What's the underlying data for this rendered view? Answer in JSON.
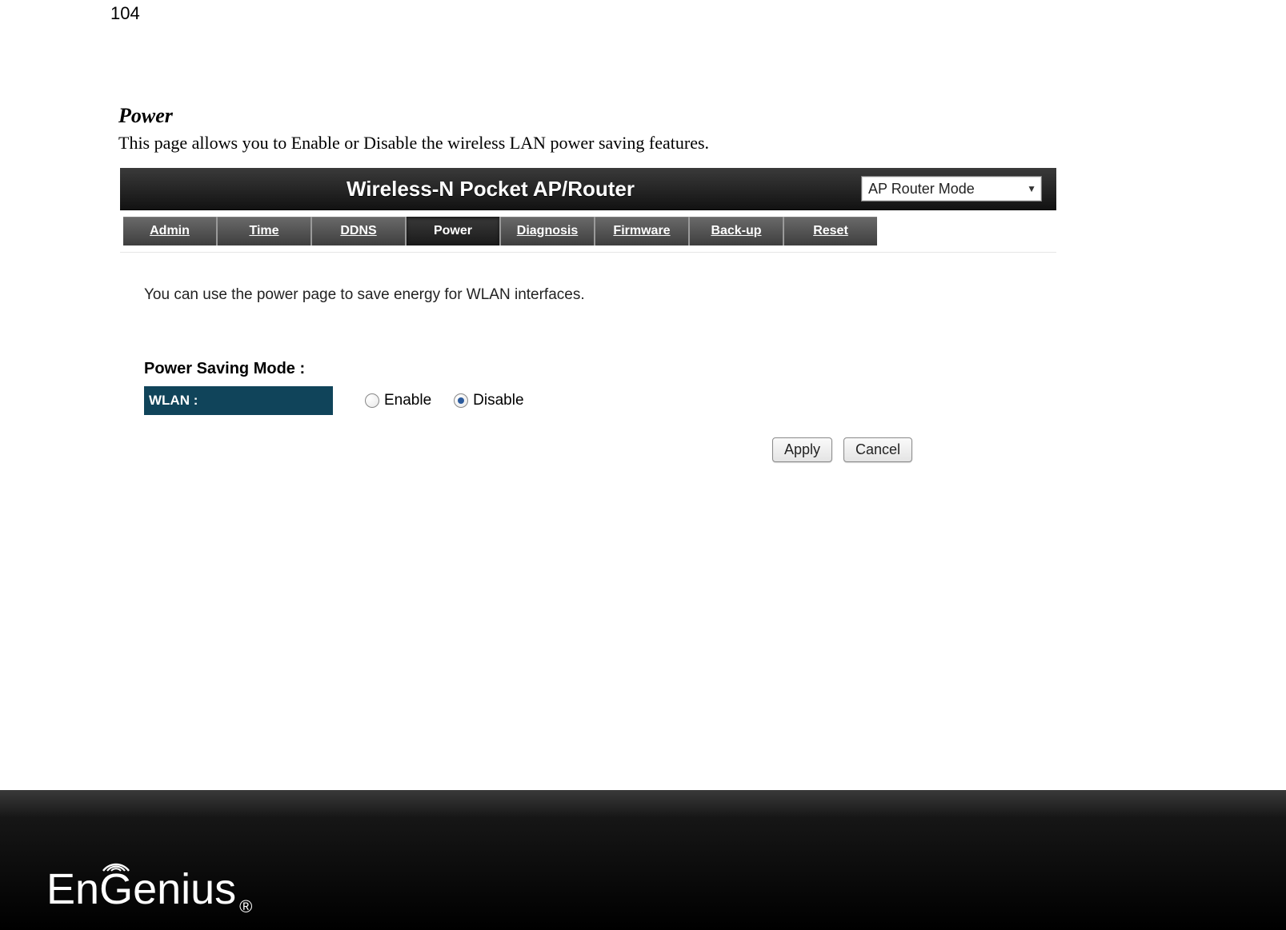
{
  "page_number": "104",
  "section": {
    "title": "Power",
    "description": "This page allows you to Enable or Disable the wireless LAN power saving features."
  },
  "router_ui": {
    "title": "Wireless-N Pocket AP/Router",
    "mode_selected": "AP Router Mode",
    "tabs": [
      "Admin",
      "Time",
      "DDNS",
      "Power",
      "Diagnosis",
      "Firmware",
      "Back-up",
      "Reset"
    ],
    "active_tab_index": 3,
    "info_text": "You can use the power page to save energy for WLAN interfaces.",
    "setting_group_label": "Power Saving Mode :",
    "setting_row_label": "WLAN :",
    "radio_options": [
      "Enable",
      "Disable"
    ],
    "radio_selected_index": 1,
    "buttons": {
      "apply": "Apply",
      "cancel": "Cancel"
    }
  },
  "footer": {
    "brand": "EnGenius",
    "registered": "®"
  }
}
